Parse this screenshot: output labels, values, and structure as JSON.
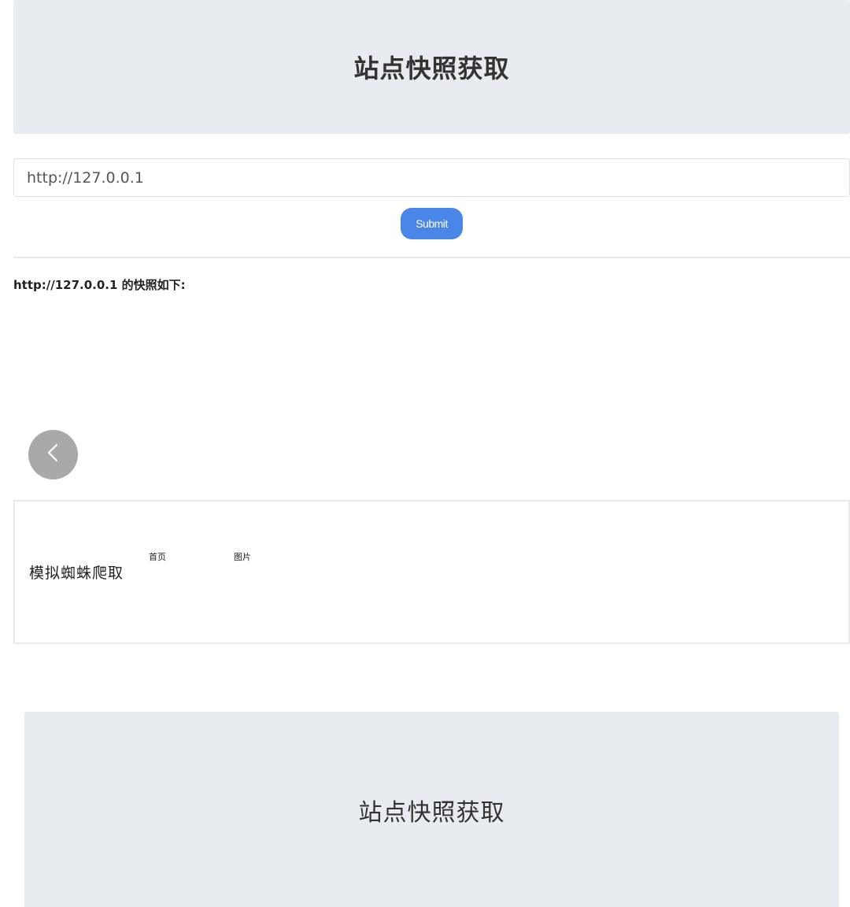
{
  "header": {
    "title": "站点快照获取"
  },
  "form": {
    "url_value": "http://127.0.0.1",
    "submit_label": "Submit"
  },
  "result": {
    "heading": "http://127.0.0.1 的快照如下:"
  },
  "back_button": {
    "icon": "chevron-left-icon"
  },
  "snapshot": {
    "logo_text": "模拟蜘蛛爬取",
    "nav": {
      "home": "首页",
      "other": "图片"
    },
    "banner_title": "站点快照获取"
  },
  "colors": {
    "accent": "#4a86e8",
    "banner_bg": "#e8ebef",
    "back_button_bg": "#a9a9a9"
  }
}
